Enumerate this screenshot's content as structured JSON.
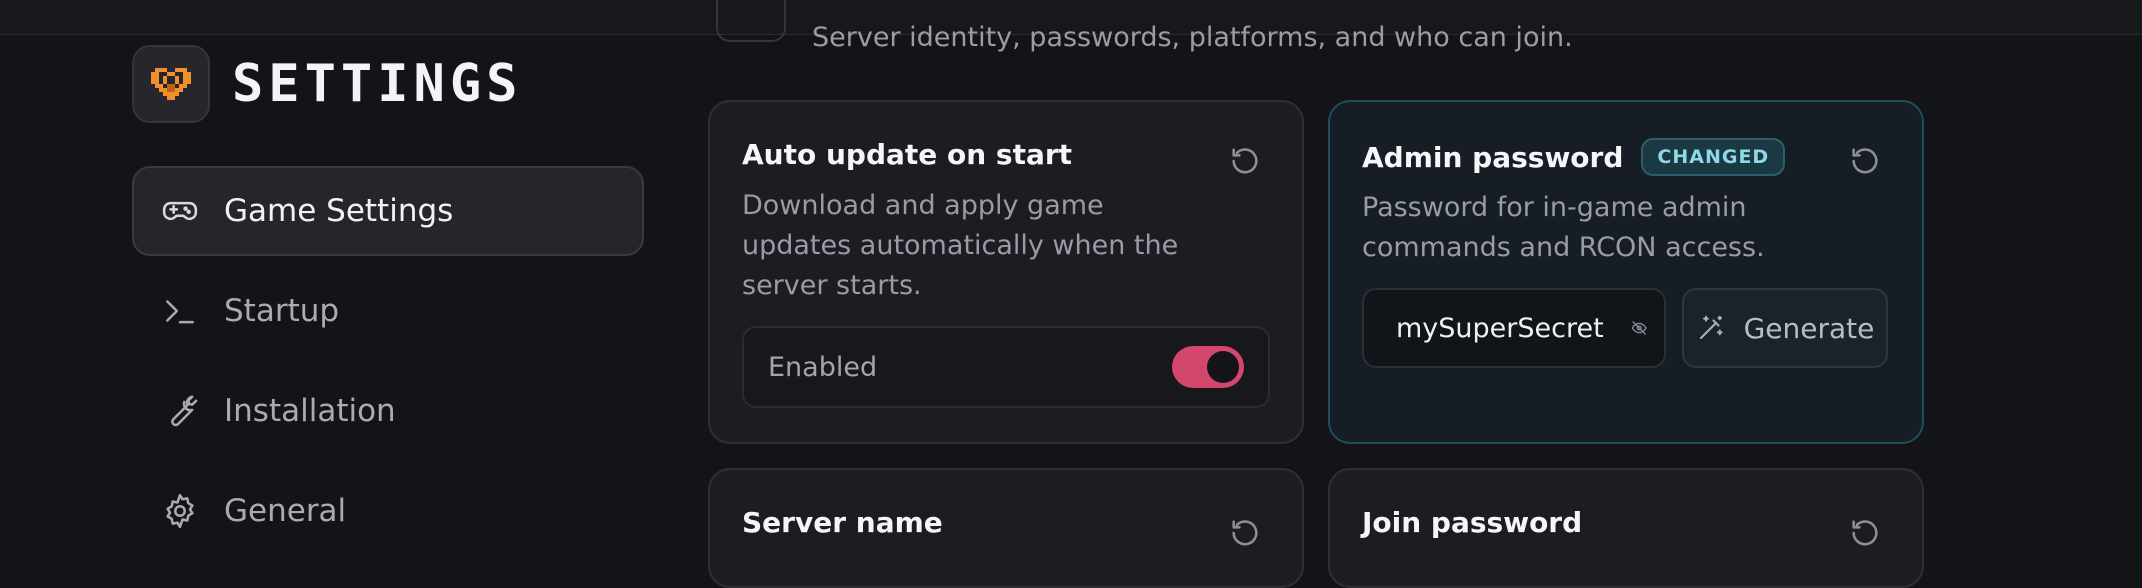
{
  "brand": {
    "title": "SETTINGS",
    "logo_icon": "heart-pixel-icon",
    "logo_color": "#f0902a"
  },
  "nav": {
    "items": [
      {
        "label": "Game Settings",
        "icon": "gamepad-icon",
        "active": true
      },
      {
        "label": "Startup",
        "icon": "terminal-prompt-icon",
        "active": false
      },
      {
        "label": "Installation",
        "icon": "wrench-icon",
        "active": false
      },
      {
        "label": "General",
        "icon": "gear-icon",
        "active": false
      }
    ]
  },
  "section": {
    "subtitle": "Server identity, passwords, platforms, and who can join."
  },
  "cards": {
    "auto_update": {
      "title": "Auto update on start",
      "description": "Download and apply game updates automatically when the server starts.",
      "toggle_label": "Enabled",
      "toggle_on": true
    },
    "admin_password": {
      "title": "Admin password",
      "badge": "CHANGED",
      "description": "Password for in-game admin commands and RCON access.",
      "value": "mySuperSecret",
      "generate_label": "Generate"
    },
    "server_name": {
      "title": "Server name"
    },
    "join_password": {
      "title": "Join password"
    }
  },
  "colors": {
    "accent_toggle": "#d2476b",
    "changed_border": "#1f4f5a",
    "badge_text": "#8fd9e6"
  }
}
